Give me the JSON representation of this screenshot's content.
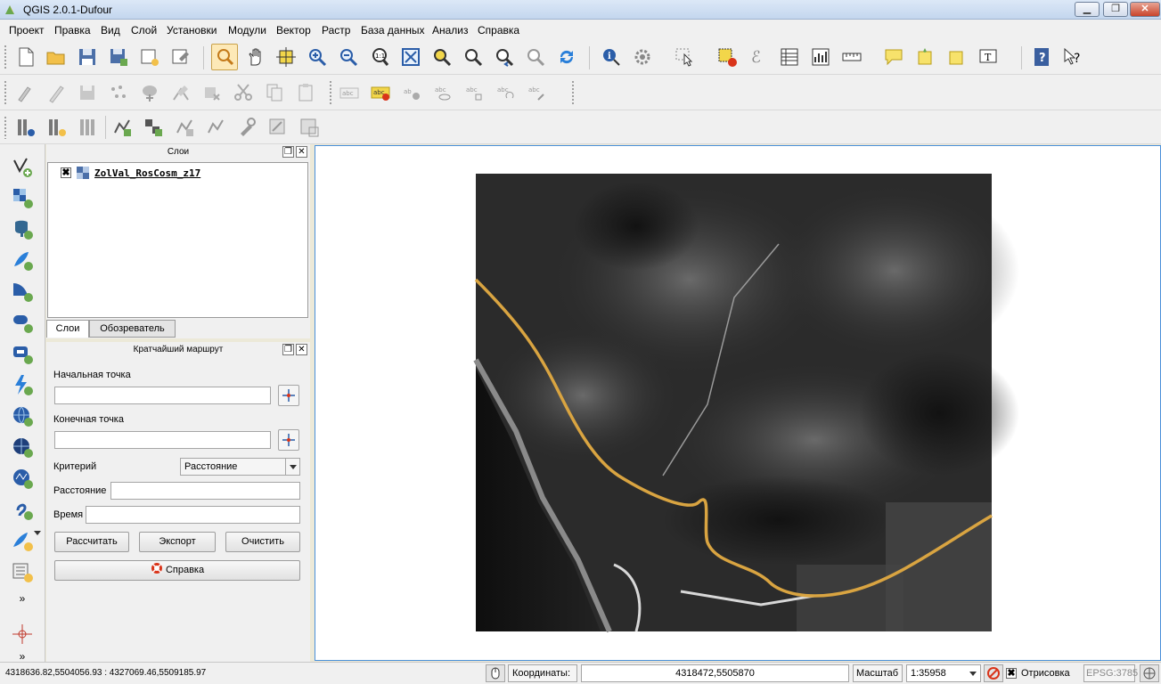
{
  "window": {
    "title": "QGIS 2.0.1-Dufour",
    "buttons": [
      "▁",
      "❐",
      "✕"
    ]
  },
  "menu": [
    "Проект",
    "Правка",
    "Вид",
    "Слой",
    "Установки",
    "Модули",
    "Вектор",
    "Растр",
    "База данных",
    "Анализ",
    "Справка"
  ],
  "layers_panel": {
    "title": "Слои",
    "layers": [
      {
        "name": "ZolVal_RosCosm_z17",
        "checked": "✖"
      }
    ],
    "tabs": [
      "Слои",
      "Обозреватель"
    ]
  },
  "route_panel": {
    "title": "Кратчайший маршрут",
    "start_label": "Начальная точка",
    "end_label": "Конечная точка",
    "criterion_label": "Критерий",
    "criterion_value": "Расстояние",
    "distance_label": "Расстояние",
    "time_label": "Время",
    "calculate_button": "Рассчитать",
    "export_button": "Экспорт",
    "clear_button": "Очистить",
    "help_button": "Справка"
  },
  "statusbar": {
    "extent": "4318636.82,5504056.93 : 4327069.46,5509185.97",
    "coords_label": "Координаты:",
    "coords_value": "4318472,5505870",
    "scale_label": "Масштаб",
    "scale_value": "1:35958",
    "render_label": "Отрисовка",
    "render_checked": "✖",
    "crs": "EPSG:3785"
  },
  "colors": {
    "accent": "#4a90d9",
    "route": "#d9a441",
    "imagery_dark": "#2b2b2b"
  }
}
